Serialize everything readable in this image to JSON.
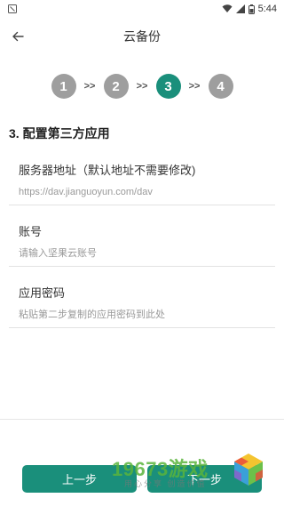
{
  "status_bar": {
    "time": "5:44",
    "icons": [
      "notification-icon",
      "wifi-icon",
      "signal-icon",
      "battery-icon"
    ]
  },
  "app_bar": {
    "title": "云备份",
    "back_icon": "arrow-left-icon"
  },
  "stepper": {
    "steps": [
      "1",
      "2",
      "3",
      "4"
    ],
    "separator": ">>",
    "active_step": "3",
    "colors": {
      "active": "#1a8f7b",
      "inactive": "#9e9e9e"
    }
  },
  "section": {
    "title": "3. 配置第三方应用"
  },
  "fields": [
    {
      "label": "服务器地址（默认地址不需要修改)",
      "value": "https://dav.jianguoyun.com/dav"
    },
    {
      "label": "账号",
      "placeholder": "请输入坚果云账号"
    },
    {
      "label": "应用密码",
      "placeholder": "粘贴第二步复制的应用密码到此处"
    }
  ],
  "buttons": {
    "prev": "上一步",
    "next": "下一步"
  },
  "watermark": {
    "text": "19673游戏",
    "subtitle": "用心分享 创造价值"
  },
  "colors": {
    "accent": "#1a8f7b"
  }
}
